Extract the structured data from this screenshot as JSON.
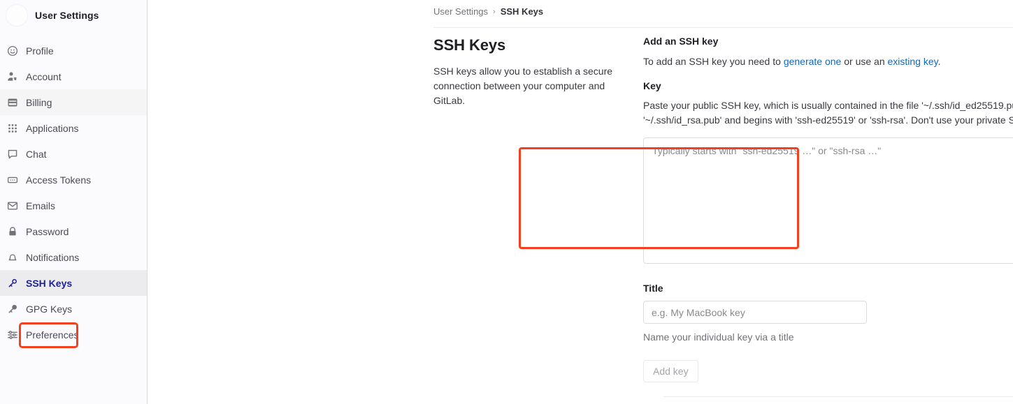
{
  "sidebar": {
    "title": "User Settings",
    "avatar": "user-avatar",
    "items": [
      {
        "label": "Profile",
        "icon": "profile-icon",
        "active": false
      },
      {
        "label": "Account",
        "icon": "account-icon",
        "active": false
      },
      {
        "label": "Billing",
        "icon": "billing-icon",
        "active": false
      },
      {
        "label": "Applications",
        "icon": "applications-icon",
        "active": false
      },
      {
        "label": "Chat",
        "icon": "chat-icon",
        "active": false
      },
      {
        "label": "Access Tokens",
        "icon": "access-tokens-icon",
        "active": false
      },
      {
        "label": "Emails",
        "icon": "emails-icon",
        "active": false
      },
      {
        "label": "Password",
        "icon": "password-icon",
        "active": false
      },
      {
        "label": "Notifications",
        "icon": "notifications-icon",
        "active": false
      },
      {
        "label": "SSH Keys",
        "icon": "ssh-keys-icon",
        "active": true
      },
      {
        "label": "GPG Keys",
        "icon": "gpg-keys-icon",
        "active": false
      },
      {
        "label": "Preferences",
        "icon": "preferences-icon",
        "active": false
      }
    ]
  },
  "breadcrumb": {
    "parent": "User Settings",
    "separator": "›",
    "current": "SSH Keys"
  },
  "page": {
    "title": "SSH Keys",
    "description": "SSH keys allow you to establish a secure connection between your computer and GitLab."
  },
  "add_key": {
    "section_title": "Add an SSH key",
    "intro_prefix": "To add an SSH key you need to ",
    "link_generate": "generate one",
    "intro_middle": " or use an ",
    "link_existing": "existing key",
    "intro_suffix": ".",
    "key_label": "Key",
    "key_help": "Paste your public SSH key, which is usually contained in the file '~/.ssh/id_ed25519.pub' or '~/.ssh/id_rsa.pub' and begins with 'ssh-ed25519' or 'ssh-rsa'. Don't use your private SSH key.",
    "key_placeholder": "Typically starts with \"ssh-ed25519 …\" or \"ssh-rsa …\"",
    "key_value": "",
    "title_label": "Title",
    "title_placeholder": "e.g. My MacBook key",
    "title_value": "",
    "title_hint": "Name your individual key via a title",
    "submit_label": "Add key"
  },
  "annotations": {
    "highlight_color": "#f2411f",
    "targets": [
      "sidebar-item-ssh-keys",
      "ssh-key-textarea"
    ]
  },
  "colors": {
    "link": "#1068bf",
    "active_nav_text": "#1f1f99",
    "active_nav_bg": "#ececef",
    "sidebar_bg": "#fbfafd",
    "border": "#dcdcde"
  }
}
